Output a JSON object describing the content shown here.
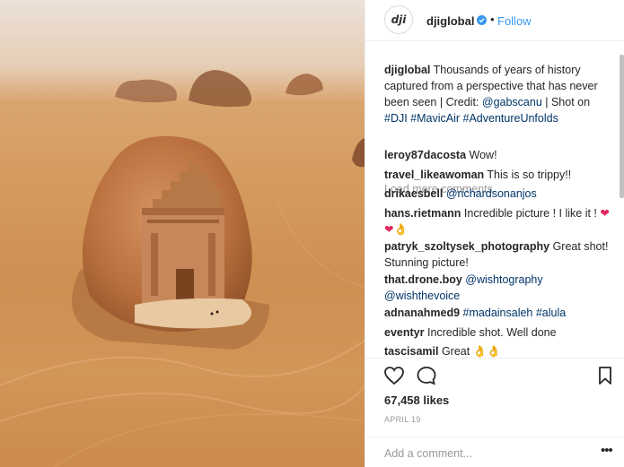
{
  "post": {
    "account": "djiglobal",
    "avatar_text": "dji",
    "separator": "•",
    "follow_label": "Follow",
    "caption": {
      "user": "djiglobal",
      "text": "Thousands of years of history captured from a perspective that has never been seen | Credit: ",
      "mention": "@gabscanu",
      "text2": " | Shot on ",
      "hashtags": "#DJI #MavicAir #AdventureUnfolds"
    },
    "load_more": "Load more comments",
    "comments": [
      {
        "user": "leroy87dacosta",
        "text": "Wow!"
      },
      {
        "user": "travel_likeawoman",
        "text": "This is so trippy!!"
      },
      {
        "user": "drikaesbell",
        "tag": "@richardsonanjos"
      },
      {
        "user": "hans.rietmann",
        "text": "Incredible picture ! I like it !",
        "emoji": "❤❤👌"
      },
      {
        "user": "patryk_szoltysek_photography",
        "text": "Great shot! Stunning picture!"
      },
      {
        "user": "that.drone.boy",
        "tag": "@wishtography @wishthevoice"
      },
      {
        "user": "adnanahmed9",
        "tag": "#madainsaleh #alula"
      },
      {
        "user": "eventyr",
        "text": "Incredible shot. Well done"
      },
      {
        "user": "tascisamil",
        "text": "Great",
        "emoji": "👌👌"
      }
    ],
    "likes": "67,458 likes",
    "date": "APRIL 19",
    "add_comment_placeholder": "Add a comment...",
    "more_label": "•••",
    "icons": {
      "like": "heart-icon",
      "comment": "comment-bubble-icon",
      "save": "bookmark-icon",
      "verified": "verified-badge-icon"
    },
    "colors": {
      "link": "#3897f0",
      "hashtag": "#003569",
      "muted": "#999999"
    }
  }
}
